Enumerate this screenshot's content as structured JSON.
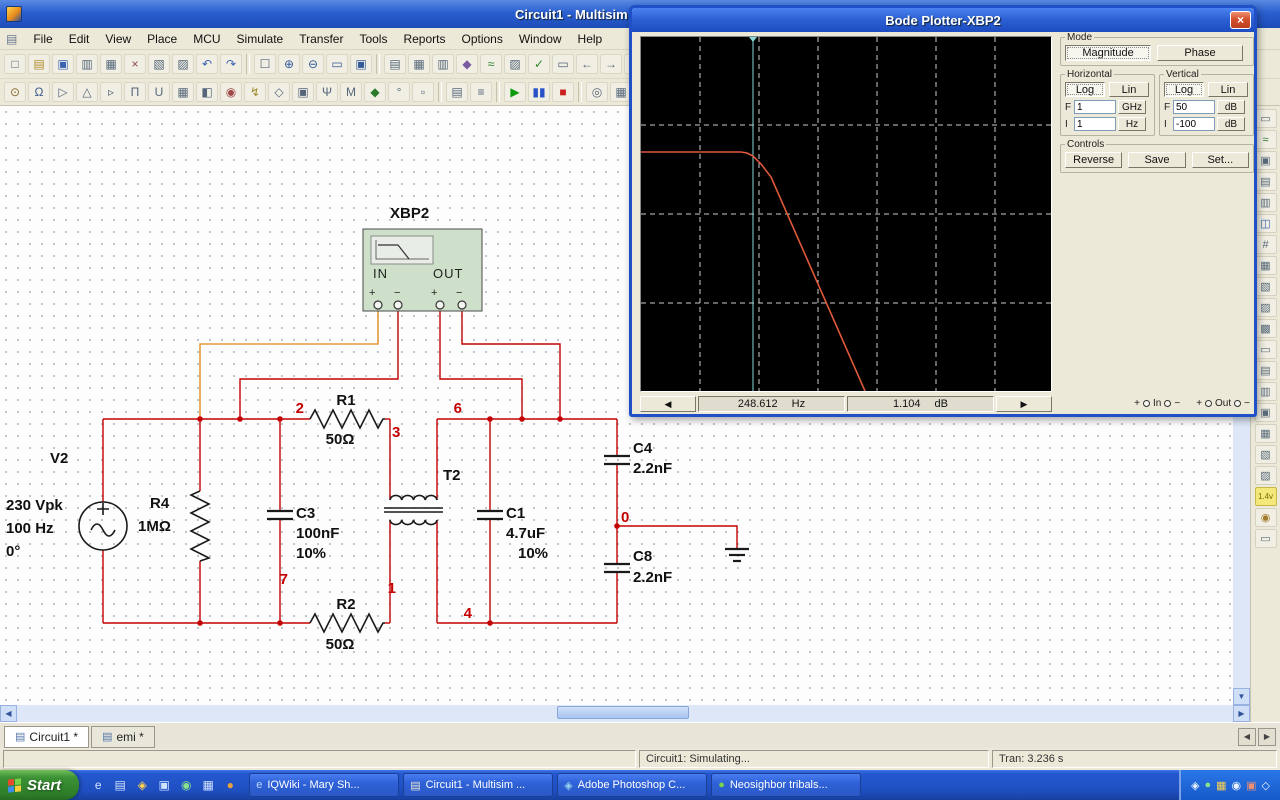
{
  "window": {
    "title": "Circuit1 - Multisim"
  },
  "icons": {
    "sheet": "▤",
    "up": "▲",
    "down": "▼",
    "left": "◀",
    "right": "▶"
  },
  "menu": {
    "items": [
      {
        "label": "File",
        "name": "menu-file"
      },
      {
        "label": "Edit",
        "name": "menu-edit"
      },
      {
        "label": "View",
        "name": "menu-view"
      },
      {
        "label": "Place",
        "name": "menu-place"
      },
      {
        "label": "MCU",
        "name": "menu-mcu"
      },
      {
        "label": "Simulate",
        "name": "menu-simulate"
      },
      {
        "label": "Transfer",
        "name": "menu-transfer"
      },
      {
        "label": "Tools",
        "name": "menu-tools"
      },
      {
        "label": "Reports",
        "name": "menu-reports"
      },
      {
        "label": "Options",
        "name": "menu-options"
      },
      {
        "label": "Window",
        "name": "menu-window"
      },
      {
        "label": "Help",
        "name": "menu-help"
      }
    ]
  },
  "toolbar_main": {
    "items": [
      {
        "glyph": "□",
        "name": "new-icon"
      },
      {
        "glyph": "▤",
        "name": "open-icon",
        "color": "#b08a2a"
      },
      {
        "glyph": "▣",
        "name": "save-icon",
        "color": "#3a62b0"
      },
      {
        "glyph": "▥",
        "name": "print-icon"
      },
      {
        "glyph": "▦",
        "name": "print-preview-icon"
      },
      {
        "glyph": "×",
        "name": "cut-icon",
        "color": "#8a4a4a"
      },
      {
        "glyph": "▧",
        "name": "copy-icon"
      },
      {
        "glyph": "▨",
        "name": "paste-icon"
      },
      {
        "glyph": "↶",
        "name": "undo-icon",
        "color": "#3a62b0"
      },
      {
        "glyph": "↷",
        "name": "redo-icon",
        "color": "#3a62b0"
      },
      {
        "cls": "sep",
        "name": "toolbar-separator",
        "inter": false
      },
      {
        "glyph": "☐",
        "name": "fullscreen-icon"
      },
      {
        "glyph": "⊕",
        "name": "zoom-in-icon",
        "color": "#345a9a"
      },
      {
        "glyph": "⊖",
        "name": "zoom-out-icon",
        "color": "#345a9a"
      },
      {
        "glyph": "▭",
        "name": "zoom-area-icon",
        "color": "#345a9a"
      },
      {
        "glyph": "▣",
        "name": "zoom-fit-icon",
        "color": "#345a9a"
      },
      {
        "cls": "sep",
        "name": "toolbar-separator",
        "inter": false
      },
      {
        "glyph": "▤",
        "name": "design-toolbox-icon"
      },
      {
        "glyph": "▦",
        "name": "spreadsheet-view-icon"
      },
      {
        "glyph": "▥",
        "name": "database-manager-icon"
      },
      {
        "glyph": "◆",
        "name": "create-component-icon",
        "color": "#7a5aa0"
      },
      {
        "glyph": "≈",
        "name": "grapher-icon",
        "color": "#2a7a2a"
      },
      {
        "glyph": "▨",
        "name": "postprocessor-icon"
      },
      {
        "glyph": "✓",
        "name": "electrical-rules-check-icon",
        "color": "#2a8a2a"
      },
      {
        "glyph": "▭",
        "name": "capture-area-icon"
      },
      {
        "glyph": "←",
        "name": "back-annotate-icon"
      },
      {
        "glyph": "→",
        "name": "forward-annotate-icon"
      },
      {
        "glyph": "?",
        "name": "help-icon",
        "color": "#3a62b0"
      }
    ]
  },
  "toolbar_components": {
    "items": [
      {
        "glyph": "⊙",
        "name": "source-components-icon",
        "color": "#8a6a2a"
      },
      {
        "glyph": "Ω",
        "name": "basic-components-icon",
        "color": "#3a5a8a"
      },
      {
        "glyph": "▷",
        "name": "diode-components-icon"
      },
      {
        "glyph": "△",
        "name": "transistor-components-icon"
      },
      {
        "glyph": "▹",
        "name": "analog-components-icon"
      },
      {
        "glyph": "Π",
        "name": "ttl-components-icon"
      },
      {
        "glyph": "U",
        "name": "cmos-components-icon"
      },
      {
        "glyph": "▦",
        "name": "misc-digital-components-icon"
      },
      {
        "glyph": "◧",
        "name": "mixed-components-icon"
      },
      {
        "glyph": "◉",
        "name": "indicator-components-icon",
        "color": "#a04a4a"
      },
      {
        "glyph": "↯",
        "name": "power-components-icon",
        "color": "#a08a2a"
      },
      {
        "glyph": "◇",
        "name": "misc-components-icon"
      },
      {
        "glyph": "▣",
        "name": "advanced-peripherals-icon"
      },
      {
        "glyph": "Ψ",
        "name": "rf-components-icon"
      },
      {
        "glyph": "M",
        "name": "electromechanical-components-icon"
      },
      {
        "glyph": "◆",
        "name": "ni-components-icon",
        "color": "#2a7a2a"
      },
      {
        "glyph": "°",
        "name": "connector-components-icon"
      },
      {
        "glyph": "▫",
        "name": "mcu-components-icon"
      },
      {
        "cls": "sep",
        "name": "toolbar-separator",
        "inter": false
      },
      {
        "glyph": "▤",
        "name": "hierarchical-block-icon"
      },
      {
        "glyph": "≡",
        "name": "place-bus-icon"
      },
      {
        "cls": "sep",
        "name": "toolbar-separator",
        "inter": false
      },
      {
        "glyph": "▶",
        "name": "run-simulation-button",
        "color": "#0a9a0a"
      },
      {
        "glyph": "▮▮",
        "name": "pause-simulation-button",
        "color": "#2a52c8"
      },
      {
        "glyph": "■",
        "name": "stop-simulation-button",
        "color": "#cc2020"
      },
      {
        "cls": "sep",
        "name": "toolbar-separator",
        "inter": false
      },
      {
        "glyph": "◎",
        "name": "measurement-probe-toolbar-icon"
      },
      {
        "glyph": "▦",
        "name": "analyses-icon"
      },
      {
        "glyph": "≈",
        "name": "grapher-view-icon",
        "color": "#2a7a2a"
      },
      {
        "glyph": "▾",
        "name": "more-options-icon"
      }
    ]
  },
  "instruments": {
    "items": [
      {
        "glyph": "▭",
        "name": "multimeter-icon"
      },
      {
        "glyph": "≈",
        "name": "function-generator-icon",
        "color": "#2a7a2a"
      },
      {
        "glyph": "▣",
        "name": "wattmeter-icon"
      },
      {
        "glyph": "▤",
        "name": "oscilloscope-icon"
      },
      {
        "glyph": "▥",
        "name": "four-channel-oscilloscope-icon"
      },
      {
        "glyph": "◫",
        "name": "bode-plotter-icon",
        "color": "#3a62b0"
      },
      {
        "glyph": "#",
        "name": "frequency-counter-icon"
      },
      {
        "glyph": "▦",
        "name": "word-generator-icon"
      },
      {
        "glyph": "▧",
        "name": "logic-analyzer-icon"
      },
      {
        "glyph": "▨",
        "name": "logic-converter-icon"
      },
      {
        "glyph": "▩",
        "name": "iv-analyzer-icon"
      },
      {
        "glyph": "▭",
        "name": "distortion-analyzer-icon"
      },
      {
        "glyph": "▤",
        "name": "spectrum-analyzer-icon"
      },
      {
        "glyph": "▥",
        "name": "network-analyzer-icon"
      },
      {
        "glyph": "▣",
        "name": "agilent-function-generator-icon"
      },
      {
        "glyph": "▦",
        "name": "agilent-multimeter-icon"
      },
      {
        "glyph": "▧",
        "name": "agilent-oscilloscope-icon"
      },
      {
        "glyph": "▨",
        "name": "tektronix-oscilloscope-icon"
      },
      {
        "glyph": "1.4v",
        "name": "measurement-probe-icon",
        "cls": "probe"
      },
      {
        "glyph": "◉",
        "name": "current-probe-icon",
        "color": "#a07a2a"
      },
      {
        "glyph": "▭",
        "name": "labview-instrument-icon"
      }
    ]
  },
  "circuit": {
    "instrument": {
      "title": "XBP2",
      "in": "IN",
      "out": "OUT",
      "plus": "+",
      "minus": "−"
    },
    "v2": {
      "ref": "V2",
      "l1": "230 Vpk",
      "l2": "100 Hz",
      "l3": "0°"
    },
    "r4": {
      "ref": "R4",
      "val": "1MΩ"
    },
    "r1": {
      "ref": "R1",
      "val": "50Ω"
    },
    "r2": {
      "ref": "R2",
      "val": "50Ω"
    },
    "c3": {
      "ref": "C3",
      "val": "100nF",
      "tol": "10%"
    },
    "c1": {
      "ref": "C1",
      "val": "4.7uF",
      "tol": "10%"
    },
    "c4": {
      "ref": "C4",
      "val": "2.2nF"
    },
    "c8": {
      "ref": "C8",
      "val": "2.2nF"
    },
    "t2": {
      "ref": "T2"
    },
    "nodes": {
      "n0": "0",
      "n1": "1",
      "n2": "2",
      "n3": "3",
      "n4": "4",
      "n6": "6",
      "n7": "7"
    }
  },
  "bode": {
    "title": "Bode Plotter-XBP2",
    "close": "×",
    "mode_label": "Mode",
    "magnitude_label": "Magnitude",
    "phase_label": "Phase",
    "horizontal_label": "Horizontal",
    "vertical_label": "Vertical",
    "log_label": "Log",
    "lin_label": "Lin",
    "f_label": "F",
    "i_label": "I",
    "h_f_value": "1",
    "h_f_unit": "GHz",
    "h_i_value": "1",
    "h_i_unit": "Hz",
    "v_f_value": "50",
    "v_f_unit": "dB",
    "v_i_value": "-100",
    "v_i_unit": "dB",
    "controls_label": "Controls",
    "reverse_label": "Reverse",
    "save_label": "Save",
    "set_label": "Set...",
    "freq_value": "248.612",
    "freq_unit": "Hz",
    "db_value": "1.104",
    "db_unit": "dB",
    "in_label": "In",
    "out_label": "Out",
    "plus": "+",
    "minus": "−",
    "left_arrow": "◀",
    "right_arrow": "▶",
    "curve_points": "0,115 100,115 106,116 112,119 120,127 130,140 224,354",
    "cursor_x": "112"
  },
  "tabs": [
    {
      "label": "Circuit1 *"
    },
    {
      "label": "emi *"
    }
  ],
  "status": {
    "simulating": "Circuit1: Simulating...",
    "tran": "Tran: 3.236 s"
  },
  "taskbar": {
    "start_label": "Start",
    "quicklaunch": [
      {
        "glyph": "e",
        "name": "quicklaunch-ie-icon",
        "color": "#cfe2ff"
      },
      {
        "glyph": "▤",
        "name": "quicklaunch-desktop-icon",
        "color": "#cfe2ff"
      },
      {
        "glyph": "◈",
        "name": "quicklaunch-media-icon",
        "color": "#ffd34e"
      },
      {
        "glyph": "▣",
        "name": "quicklaunch-folder-icon",
        "color": "#cfe2ff"
      },
      {
        "glyph": "◉",
        "name": "quicklaunch-app-icon",
        "color": "#8ae08a"
      },
      {
        "glyph": "▦",
        "name": "quicklaunch-tool-icon",
        "color": "#cfe2ff"
      },
      {
        "glyph": "●",
        "name": "quicklaunch-dot-icon",
        "color": "#e8a13c"
      }
    ],
    "tasks": [
      {
        "icon": "e",
        "label": "IQWiki - Mary Sh...",
        "color": "#bcd8ff",
        "name": "taskbar-task-browser"
      },
      {
        "icon": "▤",
        "label": "Circuit1 - Multisim ...",
        "color": "#e8e4d0",
        "name": "taskbar-task-multisim"
      },
      {
        "icon": "◈",
        "label": "Adobe Photoshop C...",
        "color": "#9ad4f0",
        "name": "taskbar-task-photoshop"
      },
      {
        "icon": "●",
        "label": "Neosighbor tribals...",
        "color": "#7ad14a",
        "name": "taskbar-task-other"
      }
    ],
    "tray": [
      {
        "glyph": "◈",
        "name": "tray-icon-display"
      },
      {
        "glyph": "●",
        "name": "tray-icon-network",
        "color": "#8ae08a"
      },
      {
        "glyph": "▦",
        "name": "tray-icon-updates",
        "color": "#ffd34e"
      },
      {
        "glyph": "◉",
        "name": "tray-icon-volume"
      },
      {
        "glyph": "▣",
        "name": "tray-icon-antivirus",
        "color": "#f09072"
      },
      {
        "glyph": "◇",
        "name": "tray-icon-messenger"
      }
    ]
  }
}
